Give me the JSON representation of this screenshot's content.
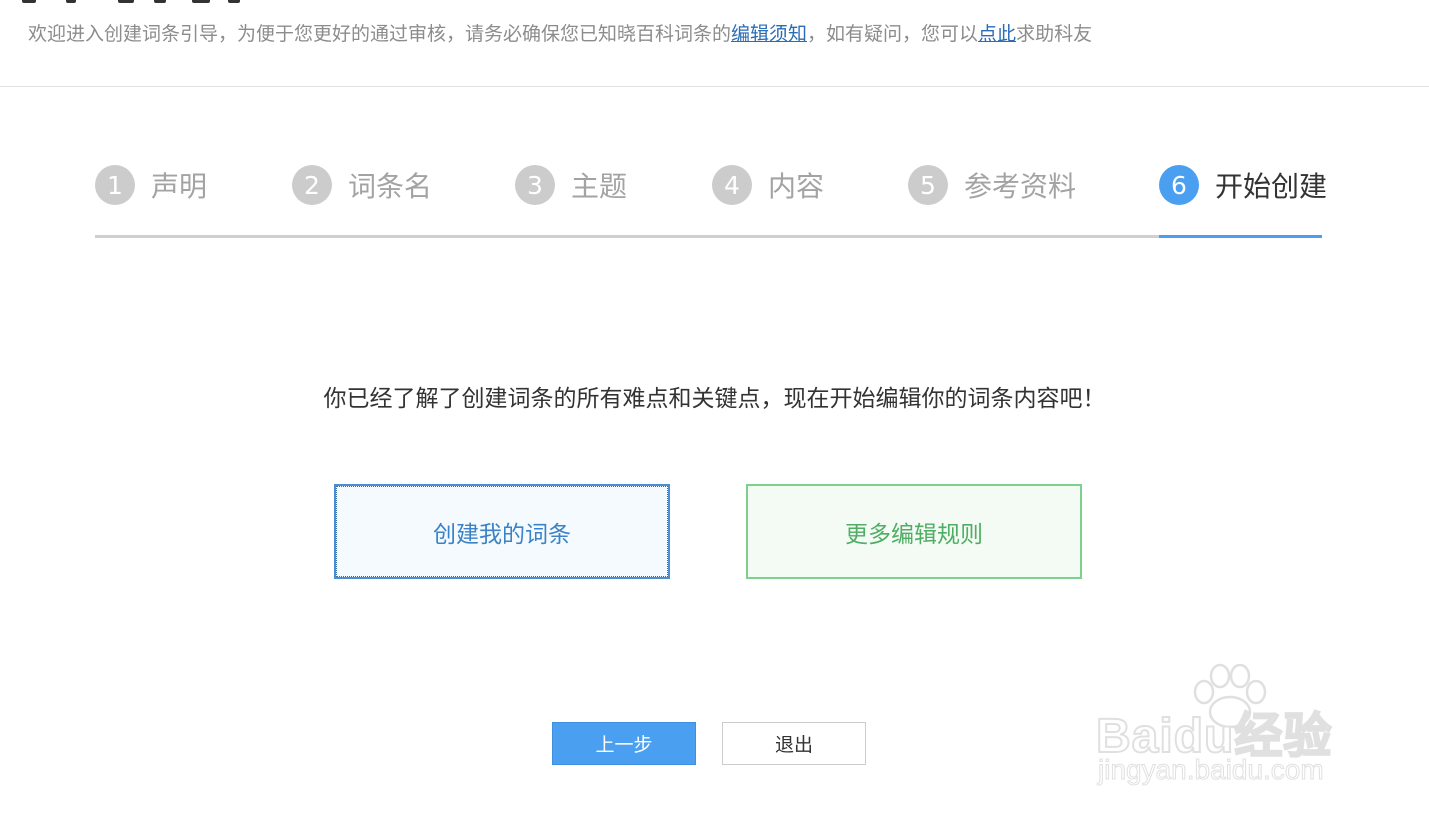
{
  "notice": {
    "text_before": "欢迎进入创建词条引导，为便于您更好的通过审核，请务必确保您已知晓百科词条的",
    "link_guidelines": "编辑须知",
    "text_middle": "，如有疑问，您可以",
    "link_help": "点此",
    "text_after": "求助科友"
  },
  "steps": [
    {
      "num": "1",
      "label": "声明"
    },
    {
      "num": "2",
      "label": "词条名"
    },
    {
      "num": "3",
      "label": "主题"
    },
    {
      "num": "4",
      "label": "内容"
    },
    {
      "num": "5",
      "label": "参考资料"
    },
    {
      "num": "6",
      "label": "开始创建",
      "active": true
    }
  ],
  "message": "你已经了解了创建词条的所有难点和关键点，现在开始编辑你的词条内容吧！",
  "actions": {
    "create_label": "创建我的词条",
    "rules_label": "更多编辑规则"
  },
  "nav": {
    "prev_label": "上一步",
    "exit_label": "退出"
  },
  "watermark": {
    "logo": "Baidu经验",
    "url": "jingyan.baidu.com"
  },
  "colors": {
    "accent_blue": "#4a9ff0",
    "link_blue": "#2a6db5",
    "green": "#4fae63",
    "inactive_gray": "#cccccc"
  }
}
